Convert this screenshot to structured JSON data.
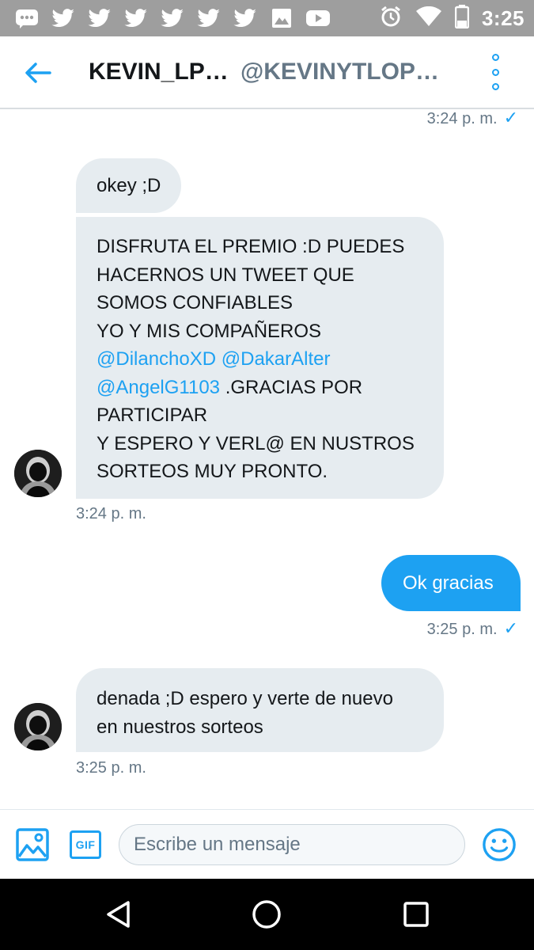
{
  "status_bar": {
    "time": "3:25",
    "icons": [
      "messaging-icon",
      "twitter-icon",
      "twitter-icon",
      "twitter-icon",
      "twitter-icon",
      "twitter-icon",
      "twitter-icon",
      "image-icon",
      "youtube-icon",
      "alarm-icon",
      "wifi-icon",
      "battery-icon"
    ]
  },
  "header": {
    "name": "KEVIN_LP…",
    "handle": "@KEVINYTLOP…"
  },
  "colors": {
    "accent": "#1da1f2",
    "incoming_bubble": "#e6ecf0",
    "muted_text": "#657786",
    "status_bar": "#9e9e9e"
  },
  "messages": [
    {
      "direction": "outgoing-timestamp",
      "timestamp": "3:24 p. m."
    },
    {
      "direction": "incoming",
      "lines": [
        "okey ;D"
      ]
    },
    {
      "direction": "incoming",
      "lines": [
        "DISFRUTA EL PREMIO :D PUEDES",
        "HACERNOS UN TWEET QUE",
        "SOMOS CONFIABLES",
        "YO Y MIS COMPAÑEROS",
        "@DilanchoXD @DakarAlter",
        "@AngelG1103 .GRACIAS POR",
        "PARTICIPAR",
        "Y ESPERO Y VERL@ EN NUSTROS",
        "SORTEOS MUY PRONTO."
      ],
      "mentions": [
        "@DilanchoXD",
        "@DakarAlter",
        "@AngelG1103"
      ],
      "line6_rest": " .GRACIAS POR",
      "timestamp": "3:24 p. m."
    },
    {
      "direction": "outgoing",
      "lines": [
        "Ok gracias"
      ],
      "timestamp": "3:25 p. m."
    },
    {
      "direction": "incoming",
      "lines": [
        "denada ;D espero y verte de nuevo",
        "en nuestros sorteos"
      ],
      "timestamp": "3:25 p. m."
    }
  ],
  "composer": {
    "placeholder": "Escribe un mensaje",
    "gif_label": "GIF"
  }
}
